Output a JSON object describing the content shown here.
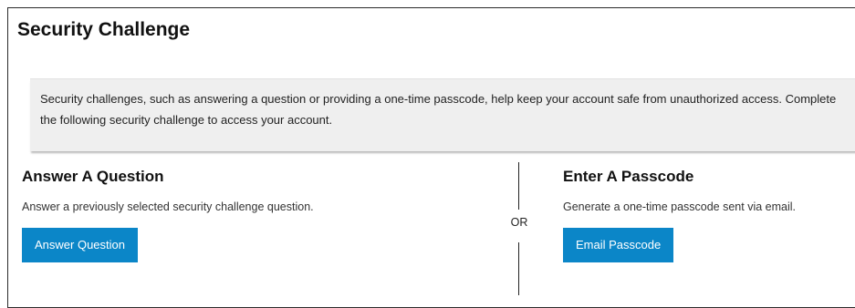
{
  "page": {
    "title": "Security Challenge"
  },
  "notice": {
    "text": "Security challenges, such as answering a question or providing a one-time passcode, help keep your account safe from unauthorized access. Complete the following security challenge to access your account."
  },
  "options": {
    "question": {
      "heading": "Answer A Question",
      "description": "Answer a previously selected security challenge question.",
      "button_label": "Answer Question"
    },
    "passcode": {
      "heading": "Enter A Passcode",
      "description": "Generate a one-time passcode sent via email.",
      "button_label": "Email Passcode"
    },
    "separator_label": "OR"
  },
  "colors": {
    "accent": "#0b86c8",
    "notice_background": "#efefef",
    "frame_border": "#2b2b2b"
  }
}
